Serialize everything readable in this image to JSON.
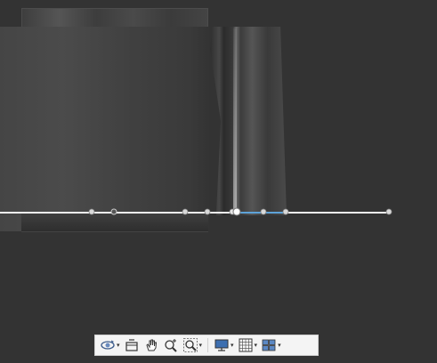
{
  "viewport": {
    "background": "#333333",
    "highlight": "#5ea3d8"
  },
  "toolbar": {
    "items": [
      {
        "icon": "orbit-icon",
        "has_dropdown": true
      },
      {
        "icon": "pan-view-icon",
        "has_dropdown": false
      },
      {
        "icon": "hand-pan-icon",
        "has_dropdown": false
      },
      {
        "icon": "zoom-realtime-icon",
        "has_dropdown": false
      },
      {
        "icon": "zoom-window-icon",
        "has_dropdown": true
      },
      {
        "icon": "display-mode-icon",
        "has_dropdown": true
      },
      {
        "icon": "grid-icon",
        "has_dropdown": true
      },
      {
        "icon": "viewports-icon",
        "has_dropdown": true
      }
    ],
    "dropdown_glyph": "▾"
  }
}
